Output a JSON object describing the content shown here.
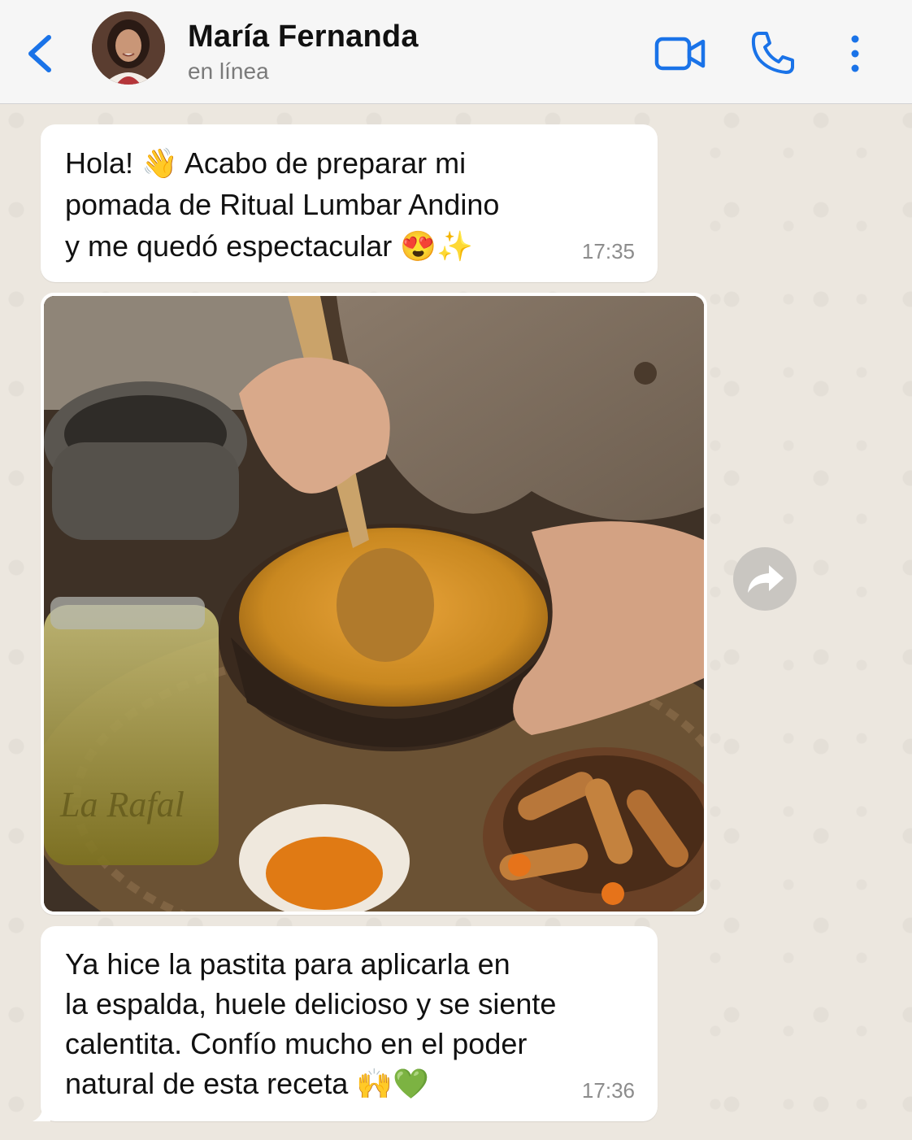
{
  "header": {
    "contact_name": "María Fernanda",
    "status": "en línea",
    "icons": [
      "back-chevron-icon",
      "video-call-icon",
      "phone-call-icon",
      "more-options-icon"
    ],
    "accent_color": "#1a73e8"
  },
  "messages": [
    {
      "text": "Hola! 👋 Acabo de preparar mi\npomada de Ritual Lumbar Andino\ny me quedó espectacular 😍✨",
      "time": "17:35"
    },
    {
      "type": "image",
      "jar_label": "La Rafal"
    },
    {
      "text": "Ya hice la pastita para aplicarla en\nla espalda, huele delicioso y se siente\ncalentita. Confío mucho en el poder\nnatural de esta receta 🙌💚",
      "time": "17:36"
    }
  ]
}
